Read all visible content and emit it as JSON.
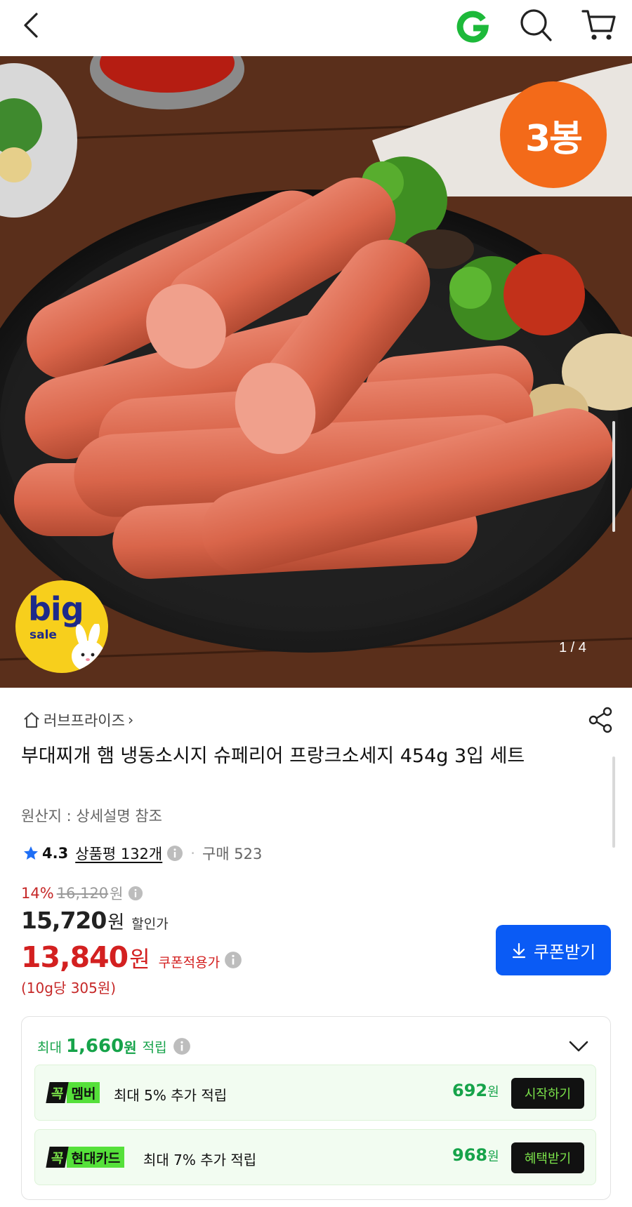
{
  "header": {
    "back_icon": "chevron-left-icon",
    "logo_icon": "g-logo-icon",
    "search_icon": "search-icon",
    "cart_icon": "cart-icon"
  },
  "hero": {
    "badge": "3봉",
    "promo_big": "big",
    "promo_sale": "sale",
    "pager": "1 / 4"
  },
  "product": {
    "store_name": "러브프라이즈",
    "store_chevron": "›",
    "title": "부대찌개 햄 냉동소시지 슈페리어 프랑크소세지 454g 3입 세트",
    "origin": "원산지 : 상세설명 참조",
    "rating": "4.3",
    "reviews": "상품평 132개",
    "dot": "·",
    "purchases": "구매 523"
  },
  "price": {
    "discount_pct": "14%",
    "original": "16,120",
    "original_unit": "원",
    "sale": "15,720",
    "sale_unit": "원",
    "sale_label": "할인가",
    "coupon_price": "13,840",
    "coupon_unit": "원",
    "coupon_label": "쿠폰적용가",
    "per_unit": "(10g당 305원)",
    "coupon_button": "쿠폰받기"
  },
  "points": {
    "prefix": "최대",
    "max_amount": "1,660",
    "max_unit": "원",
    "suffix": "적립",
    "rows": [
      {
        "tag_k": "꼭",
        "tag_name": "멤버",
        "desc": "최대 5% 추가 적립",
        "amount": "692",
        "unit": "원",
        "button": "시작하기"
      },
      {
        "tag_k": "꼭",
        "tag_name": "현대카드",
        "desc": "최대 7% 추가 적립",
        "amount": "968",
        "unit": "원",
        "button": "혜택받기"
      }
    ]
  },
  "colors": {
    "accent_blue": "#0a5bf5",
    "price_red": "#d32020",
    "points_green": "#16a34a",
    "badge_orange": "#f36a19"
  }
}
